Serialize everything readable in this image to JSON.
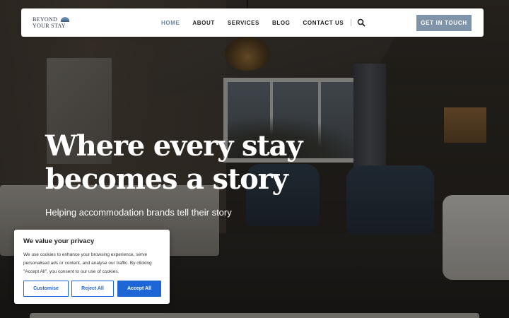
{
  "header": {
    "logo_line1": "BEYOND",
    "logo_line2": "YOUR STAY",
    "nav": [
      {
        "label": "HOME",
        "active": true
      },
      {
        "label": "ABOUT",
        "active": false
      },
      {
        "label": "SERVICES",
        "active": false
      },
      {
        "label": "BLOG",
        "active": false
      },
      {
        "label": "CONTACT US",
        "active": false
      }
    ],
    "search_icon": "search-icon",
    "cta_label": "GET IN TOUCH"
  },
  "hero": {
    "title": "Where every stay\nbecomes a story",
    "subtitle": "Helping accommodation brands tell their story"
  },
  "cookie_banner": {
    "title": "We value your privacy",
    "text": "We use cookies to enhance your browsing experience, serve personalised ads or content, and analyse our traffic. By clicking \"Accept All\", you consent to our use of cookies.",
    "customise_label": "Customise",
    "reject_label": "Reject All",
    "accept_label": "Accept All"
  },
  "colors": {
    "nav_active": "#6b86a6",
    "cta_bg": "#7f93a9",
    "cookie_accent": "#1e66d6",
    "logo": "#28344a"
  }
}
